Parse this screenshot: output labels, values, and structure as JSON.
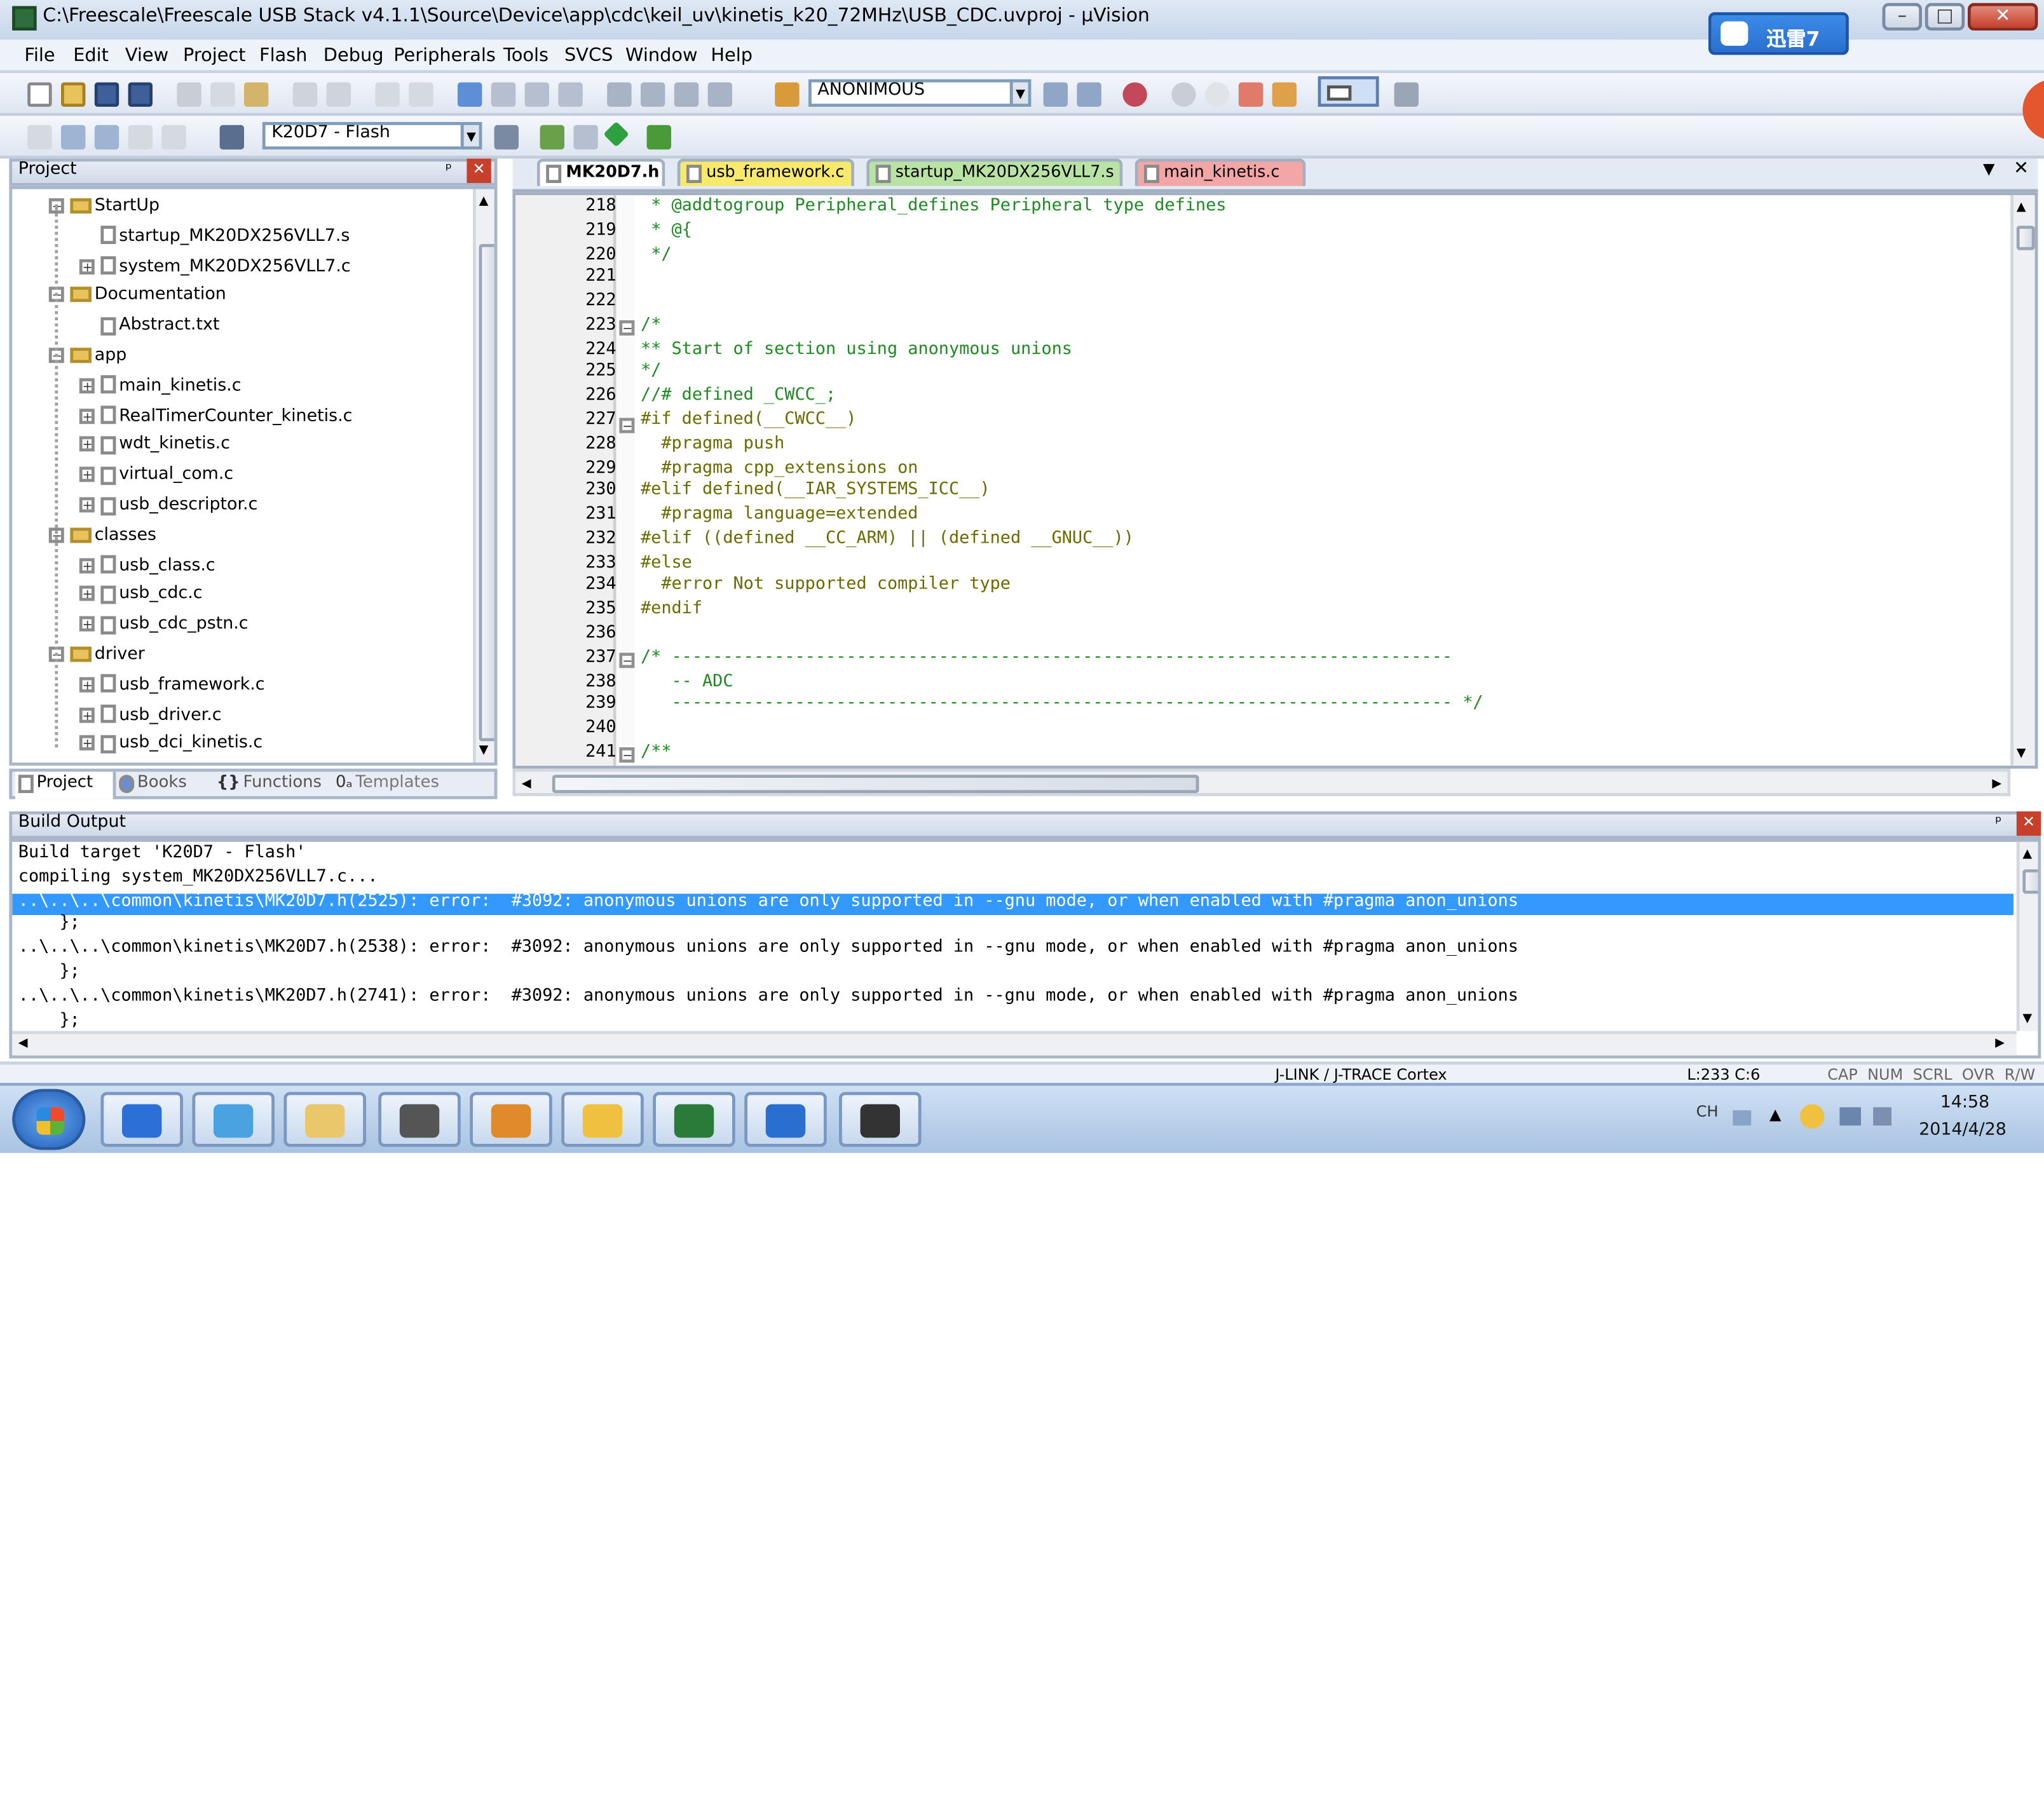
{
  "window": {
    "title": "C:\\Freescale\\Freescale USB Stack v4.1.1\\Source\\Device\\app\\cdc\\keil_uv\\kinetis_k20_72MHz\\USB_CDC.uvproj - µVision",
    "badge_text": "迅雷7",
    "minimize": "–",
    "maximize": "□",
    "close": "✕"
  },
  "menu": [
    "File",
    "Edit",
    "View",
    "Project",
    "Flash",
    "Debug",
    "Peripherals",
    "Tools",
    "SVCS",
    "Window",
    "Help"
  ],
  "toolbar": {
    "search_combo": "ANONIMOUS",
    "target_combo": "K20D7 - Flash"
  },
  "project_panel": {
    "title": "Project",
    "pin": "ᵖ",
    "close": "✕",
    "tree": [
      {
        "label": "StartUp",
        "kind": "group",
        "level": 1
      },
      {
        "label": "startup_MK20DX256VLL7.s",
        "kind": "file",
        "level": 2,
        "expandable": false
      },
      {
        "label": "system_MK20DX256VLL7.c",
        "kind": "file",
        "level": 2,
        "expandable": true
      },
      {
        "label": "Documentation",
        "kind": "group",
        "level": 1
      },
      {
        "label": "Abstract.txt",
        "kind": "file",
        "level": 2,
        "expandable": false
      },
      {
        "label": "app",
        "kind": "group",
        "level": 1
      },
      {
        "label": "main_kinetis.c",
        "kind": "file",
        "level": 2,
        "expandable": true
      },
      {
        "label": "RealTimerCounter_kinetis.c",
        "kind": "file",
        "level": 2,
        "expandable": true
      },
      {
        "label": "wdt_kinetis.c",
        "kind": "file",
        "level": 2,
        "expandable": true
      },
      {
        "label": "virtual_com.c",
        "kind": "file",
        "level": 2,
        "expandable": true
      },
      {
        "label": "usb_descriptor.c",
        "kind": "file",
        "level": 2,
        "expandable": true
      },
      {
        "label": "classes",
        "kind": "group",
        "level": 1
      },
      {
        "label": "usb_class.c",
        "kind": "file",
        "level": 2,
        "expandable": true
      },
      {
        "label": "usb_cdc.c",
        "kind": "file",
        "level": 2,
        "expandable": true
      },
      {
        "label": "usb_cdc_pstn.c",
        "kind": "file",
        "level": 2,
        "expandable": true
      },
      {
        "label": "driver",
        "kind": "group",
        "level": 1
      },
      {
        "label": "usb_framework.c",
        "kind": "file",
        "level": 2,
        "expandable": true
      },
      {
        "label": "usb_driver.c",
        "kind": "file",
        "level": 2,
        "expandable": true
      },
      {
        "label": "usb_dci_kinetis.c",
        "kind": "file",
        "level": 2,
        "expandable": true
      }
    ],
    "bottom_tabs": [
      "Project",
      "Books",
      "Functions",
      "Templates"
    ],
    "bottom_tab_icons": [
      "project-tab-icon",
      "books-tab-icon",
      "functions-tab-icon",
      "templates-tab-icon"
    ]
  },
  "editor": {
    "tabs": [
      {
        "label": "MK20D7.h",
        "color": "#ffffff",
        "active": true
      },
      {
        "label": "usb_framework.c",
        "color": "#f7e96b"
      },
      {
        "label": "startup_MK20DX256VLL7.s",
        "color": "#b9e3a4"
      },
      {
        "label": "main_kinetis.c",
        "color": "#f3a6a6"
      }
    ],
    "tab_menu": "▼",
    "tab_close": "✕",
    "lines": [
      {
        "n": "218",
        "text": " * @addtogroup Peripheral_defines Peripheral type defines",
        "cls": "c-green",
        "fold": ""
      },
      {
        "n": "219",
        "text": " * @{",
        "cls": "c-green",
        "fold": ""
      },
      {
        "n": "220",
        "text": " */",
        "cls": "c-green",
        "fold": ""
      },
      {
        "n": "221",
        "text": "",
        "cls": "",
        "fold": ""
      },
      {
        "n": "222",
        "text": "",
        "cls": "",
        "fold": ""
      },
      {
        "n": "223",
        "text": "/*",
        "cls": "c-green",
        "fold": "−"
      },
      {
        "n": "224",
        "text": "** Start of section using anonymous unions",
        "cls": "c-green",
        "fold": ""
      },
      {
        "n": "225",
        "text": "*/",
        "cls": "c-green",
        "fold": ""
      },
      {
        "n": "226",
        "text": "//# defined _CWCC_;",
        "cls": "c-green",
        "fold": ""
      },
      {
        "n": "227",
        "text": "#if defined(__CWCC__)",
        "cls": "c-pre",
        "fold": "−"
      },
      {
        "n": "228",
        "text": "  #pragma push",
        "cls": "c-pre",
        "fold": ""
      },
      {
        "n": "229",
        "text": "  #pragma cpp_extensions on",
        "cls": "c-pre",
        "fold": ""
      },
      {
        "n": "230",
        "text": "#elif defined(__IAR_SYSTEMS_ICC__)",
        "cls": "c-pre",
        "fold": ""
      },
      {
        "n": "231",
        "text": "  #pragma language=extended",
        "cls": "c-pre",
        "fold": ""
      },
      {
        "n": "232",
        "text": "#elif ((defined __CC_ARM) || (defined __GNUC__))",
        "cls": "c-pre",
        "fold": ""
      },
      {
        "n": "233",
        "text": "#else",
        "cls": "c-pre",
        "fold": ""
      },
      {
        "n": "234",
        "text": "  #error Not supported compiler type",
        "cls": "c-pre",
        "fold": ""
      },
      {
        "n": "235",
        "text": "#endif",
        "cls": "c-pre",
        "fold": ""
      },
      {
        "n": "236",
        "text": "",
        "cls": "",
        "fold": ""
      },
      {
        "n": "237",
        "text": "/* ----------------------------------------------------------------------------",
        "cls": "c-green",
        "fold": "−"
      },
      {
        "n": "238",
        "text": "   -- ADC",
        "cls": "c-green",
        "fold": ""
      },
      {
        "n": "239",
        "text": "   ---------------------------------------------------------------------------- */",
        "cls": "c-green",
        "fold": ""
      },
      {
        "n": "240",
        "text": "",
        "cls": "",
        "fold": ""
      },
      {
        "n": "241",
        "text": "/**",
        "cls": "c-green",
        "fold": "−"
      }
    ]
  },
  "build_output": {
    "title": "Build Output",
    "pin": "ᵖ",
    "close": "✕",
    "lines": [
      {
        "text": "Build target 'K20D7 - Flash'",
        "selected": false
      },
      {
        "text": "compiling system_MK20DX256VLL7.c...",
        "selected": false
      },
      {
        "text": "..\\..\\..\\common\\kinetis\\MK20D7.h(2525): error:  #3092: anonymous unions are only supported in --gnu mode, or when enabled with #pragma anon_unions",
        "selected": true
      },
      {
        "text": "    };",
        "selected": false
      },
      {
        "text": "..\\..\\..\\common\\kinetis\\MK20D7.h(2538): error:  #3092: anonymous unions are only supported in --gnu mode, or when enabled with #pragma anon_unions",
        "selected": false
      },
      {
        "text": "    };",
        "selected": false
      },
      {
        "text": "..\\..\\..\\common\\kinetis\\MK20D7.h(2741): error:  #3092: anonymous unions are only supported in --gnu mode, or when enabled with #pragma anon_unions",
        "selected": false
      },
      {
        "text": "    };",
        "selected": false
      }
    ]
  },
  "statusbar": {
    "debugger": "J-LINK / J-TRACE Cortex",
    "position": "L:233 C:6",
    "indicators": "CAP  NUM  SCRL  OVR  R/W"
  },
  "taskbar": {
    "buttons": [
      {
        "name": "start-orb-icon",
        "color": "#3f7fd8"
      },
      {
        "name": "qq-icon",
        "color": "#2c6fd6"
      },
      {
        "name": "ie-browser-icon",
        "color": "#4aa3e0"
      },
      {
        "name": "explorer-folder-icon",
        "color": "#e9c76a"
      },
      {
        "name": "disk-tool-icon",
        "color": "#555555"
      },
      {
        "name": "drawing-app-icon",
        "color": "#e08a2c"
      },
      {
        "name": "mail-icon",
        "color": "#f0c040"
      },
      {
        "name": "keil-uvision-icon",
        "color": "#2a7a3a"
      },
      {
        "name": "xunlei-icon",
        "color": "#2a6fd0"
      },
      {
        "name": "pirate-flag-icon",
        "color": "#333333"
      }
    ],
    "tray_lang": "CH",
    "time": "14:58",
    "date": "2014/4/28"
  }
}
